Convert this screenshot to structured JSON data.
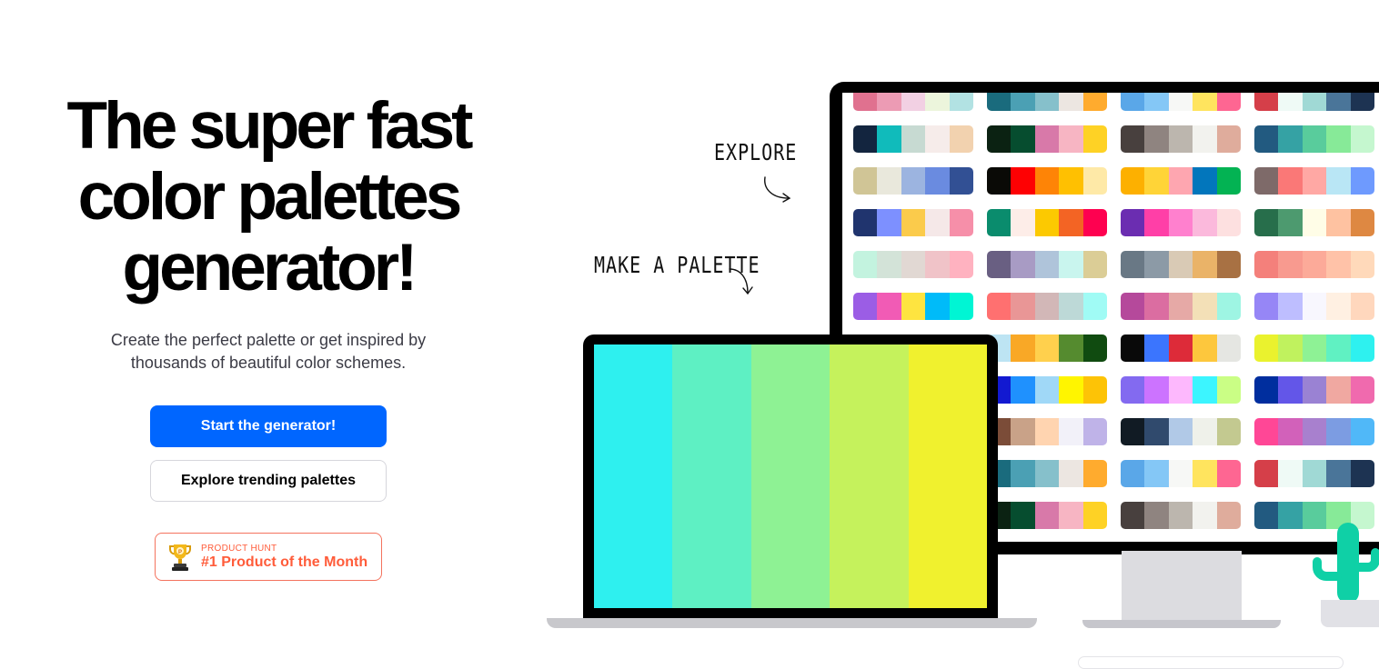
{
  "hero": {
    "headline": [
      "The super fast",
      "color palettes",
      "generator!"
    ],
    "subtitle": [
      "Create the perfect palette or get inspired by",
      "thousands of beautiful color schemes."
    ],
    "primary_button": "Start the generator!",
    "secondary_button": "Explore trending palettes",
    "badge": {
      "label_small": "PRODUCT HUNT",
      "label_big": "#1 Product of the Month",
      "icon": "trophy-icon",
      "color": "#ff5c3a"
    }
  },
  "annotations": {
    "explore": "EXPLORE",
    "make": "MAKE A PALETTE"
  },
  "colors": {
    "primary": "#0066ff",
    "device": "#000000",
    "cactus": "#0fd0a6"
  },
  "laptop_palette": [
    "#2ef0ef",
    "#5ef0c3",
    "#8ef294",
    "#c5f25c",
    "#f0f12e"
  ],
  "monitor_palettes": [
    [
      [
        "#e0718f",
        "#ec9bb4",
        "#f2d0e3",
        "#ecf5dc",
        "#b2e2e3"
      ],
      [
        "#1a6b7d",
        "#4ba0b4",
        "#86c0cb",
        "#ece6e1",
        "#ffab2e"
      ],
      [
        "#5aa7e8",
        "#84c7f6",
        "#f7f8f6",
        "#ffe45e",
        "#fe6692"
      ],
      [
        "#d53f49",
        "#effaf6",
        "#a0d9d5",
        "#4a7599",
        "#1d3352"
      ]
    ],
    [
      [
        "#13253f",
        "#10bbbb",
        "#c7dad2",
        "#f6ecea",
        "#f2d2af"
      ],
      [
        "#0b2212",
        "#064d2f",
        "#d879a9",
        "#f7b5c3",
        "#fed225"
      ],
      [
        "#48403e",
        "#8f8480",
        "#bcb6ae",
        "#f2f2ee",
        "#dfac9c"
      ],
      [
        "#225a80",
        "#35a2a4",
        "#59cc9c",
        "#87ea98",
        "#c5f7cf"
      ]
    ],
    [
      [
        "#d0c596",
        "#e9e8dc",
        "#9cb4e0",
        "#6a8be0",
        "#325094"
      ],
      [
        "#0a0a06",
        "#fe0103",
        "#fe8406",
        "#ffc001",
        "#fee9a7"
      ],
      [
        "#fdb000",
        "#ffd437",
        "#fea6b0",
        "#0276bc",
        "#03b353"
      ],
      [
        "#7e6a69",
        "#fa7877",
        "#ffa8a4",
        "#b9e6f5",
        "#6e9afe"
      ]
    ],
    [
      [
        "#20346e",
        "#7d90ff",
        "#fbcb4b",
        "#f5e8e8",
        "#f68fa9"
      ],
      [
        "#0a8c6d",
        "#fdede8",
        "#fcc901",
        "#f36424",
        "#fe0150"
      ],
      [
        "#6b2db1",
        "#ff3fa7",
        "#ff80ce",
        "#fbb9dc",
        "#fde0e0"
      ],
      [
        "#276e4b",
        "#4d9a6f",
        "#fffde7",
        "#fec2a1",
        "#de8842"
      ]
    ],
    [
      [
        "#c3f3df",
        "#d3e3d8",
        "#e1d8d3",
        "#f0c3c8",
        "#ffb2c0"
      ],
      [
        "#695f82",
        "#a89bc4",
        "#afc4da",
        "#c9f5ee",
        "#dbcd96"
      ],
      [
        "#697885",
        "#8c9aa6",
        "#d9cab5",
        "#eab368",
        "#a87143"
      ],
      [
        "#f4807b",
        "#f89a8f",
        "#fcaa99",
        "#ffc2a8",
        "#ffd9ba"
      ]
    ],
    [
      [
        "#9b5de5",
        "#f15bb5",
        "#fee440",
        "#00bbf9",
        "#00f5d4"
      ],
      [
        "#ff7070",
        "#e99696",
        "#d2b7b7",
        "#bdd9d7",
        "#a0fbf5"
      ],
      [
        "#b5499b",
        "#db6da1",
        "#e6a9a6",
        "#f3e0b7",
        "#9ef5e3"
      ],
      [
        "#9686f6",
        "#bebeff",
        "#f8f7fe",
        "#fff0e2",
        "#ffd7bd"
      ]
    ],
    [
      [
        "#cde8ee",
        "#b8dee5",
        "#a4d4de",
        "#8fc9d6",
        "#7bbfcf"
      ],
      [
        "#bde4f3",
        "#f9a826",
        "#ffd04d",
        "#558b2f",
        "#104b10"
      ],
      [
        "#090909",
        "#3b75fe",
        "#dd2b39",
        "#fdc73d",
        "#e5e6e2"
      ],
      [
        "#eaf22e",
        "#c0f25e",
        "#8ef295",
        "#60f1c2",
        "#2ef1ef"
      ]
    ],
    [
      [
        "#0b1d8e",
        "#102bc4",
        "#1b1ee0",
        "#2a1fd4",
        "#1b0fc0"
      ],
      [
        "#1219d1",
        "#1f91fe",
        "#a0d8f7",
        "#fff500",
        "#fdc306"
      ],
      [
        "#836af0",
        "#cc73ff",
        "#fdb8fd",
        "#3cf5ff",
        "#cafe85"
      ],
      [
        "#002e9e",
        "#6356e8",
        "#9a82d3",
        "#f0a8a1",
        "#f06aae"
      ]
    ],
    [
      [
        "#3b2424",
        "#4a2f2c",
        "#6b4438",
        "#7c5140",
        "#8a5a44"
      ],
      [
        "#7b4c38",
        "#c9a288",
        "#ffd4b0",
        "#f2f1f9",
        "#bfb3e8"
      ],
      [
        "#111b24",
        "#304a6d",
        "#b1c9e7",
        "#eff1ea",
        "#c3c990"
      ],
      [
        "#ff4796",
        "#d261ba",
        "#a880ce",
        "#7c9ce2",
        "#50b8f8"
      ]
    ],
    [
      [
        "#0a3a47",
        "#0e4e5b",
        "#125e6c",
        "#17707f",
        "#1c8193"
      ],
      [
        "#1a6b7d",
        "#4ba0b4",
        "#86c0cb",
        "#ece6e1",
        "#ffab2e"
      ],
      [
        "#5aa7e8",
        "#84c7f6",
        "#f7f8f6",
        "#ffe45e",
        "#fe6692"
      ],
      [
        "#d53f49",
        "#effaf6",
        "#a0d9d5",
        "#4a7599",
        "#1d3352"
      ]
    ],
    [
      [
        "#0b1d10",
        "#09220e",
        "#0b2914",
        "#0c3018",
        "#0e371c"
      ],
      [
        "#0b2212",
        "#064d2f",
        "#d879a9",
        "#f7b5c3",
        "#fed225"
      ],
      [
        "#48403e",
        "#8f8480",
        "#bcb6ae",
        "#f2f2ee",
        "#dfac9c"
      ],
      [
        "#225a80",
        "#35a2a4",
        "#59cc9c",
        "#87ea98",
        "#c5f7cf"
      ]
    ]
  ]
}
